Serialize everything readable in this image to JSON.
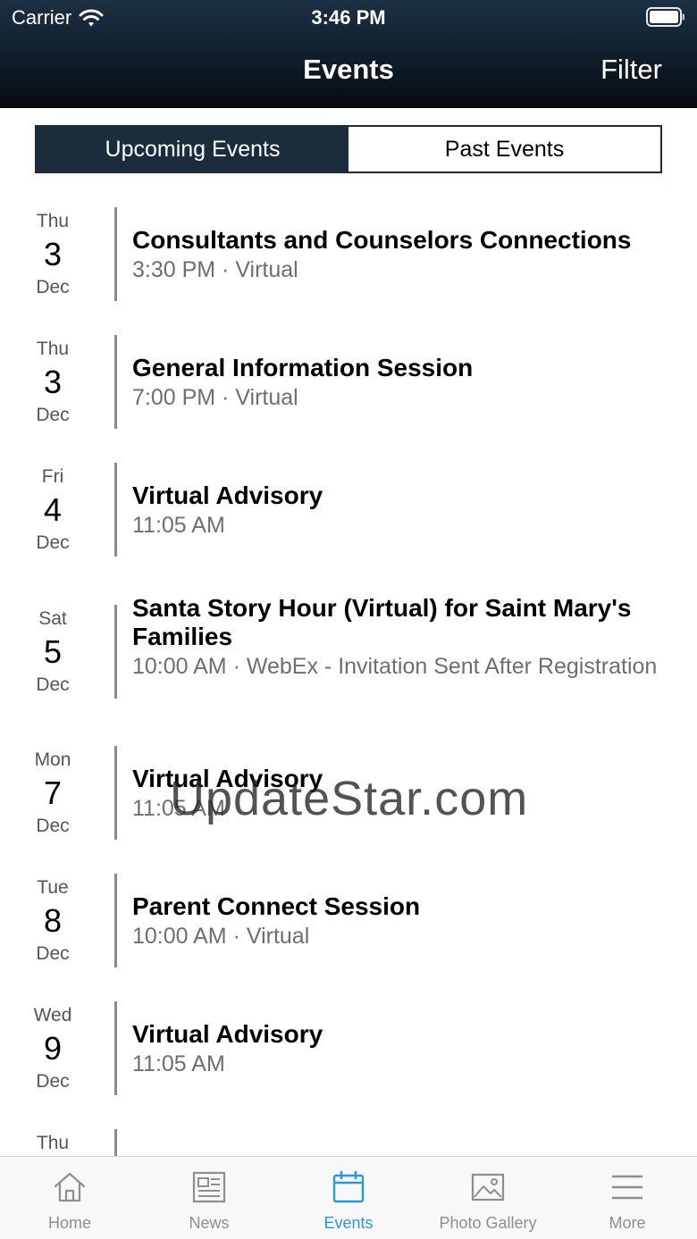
{
  "status_bar": {
    "carrier": "Carrier",
    "time": "3:46 PM"
  },
  "nav": {
    "title": "Events",
    "filter_label": "Filter"
  },
  "segments": {
    "upcoming": "Upcoming Events",
    "past": "Past Events",
    "selected": "upcoming"
  },
  "events": [
    {
      "dow": "Thu",
      "day": "3",
      "month": "Dec",
      "title": "Consultants and Counselors Connections",
      "meta": "3:30 PM · Virtual"
    },
    {
      "dow": "Thu",
      "day": "3",
      "month": "Dec",
      "title": "General Information Session",
      "meta": "7:00 PM · Virtual"
    },
    {
      "dow": "Fri",
      "day": "4",
      "month": "Dec",
      "title": "Virtual Advisory",
      "meta": "11:05 AM"
    },
    {
      "dow": "Sat",
      "day": "5",
      "month": "Dec",
      "title": "Santa Story Hour (Virtual) for Saint Mary's Families",
      "meta": "10:00 AM · WebEx - Invitation Sent After Registration"
    },
    {
      "dow": "Mon",
      "day": "7",
      "month": "Dec",
      "title": "Virtual Advisory",
      "meta": "11:05 AM"
    },
    {
      "dow": "Tue",
      "day": "8",
      "month": "Dec",
      "title": "Parent Connect Session",
      "meta": "10:00 AM · Virtual"
    },
    {
      "dow": "Wed",
      "day": "9",
      "month": "Dec",
      "title": "Virtual Advisory",
      "meta": "11:05 AM"
    },
    {
      "dow": "Thu"
    }
  ],
  "watermark": "UpdateStar.com",
  "tabbar": {
    "active": "events",
    "items": [
      {
        "id": "home",
        "label": "Home",
        "icon": "home-icon"
      },
      {
        "id": "news",
        "label": "News",
        "icon": "newspaper-icon"
      },
      {
        "id": "events",
        "label": "Events",
        "icon": "calendar-icon"
      },
      {
        "id": "photo-gallery",
        "label": "Photo Gallery",
        "icon": "image-icon"
      },
      {
        "id": "more",
        "label": "More",
        "icon": "menu-icon"
      }
    ]
  },
  "colors": {
    "header_top": "#1c3044",
    "header_bottom": "#070b10",
    "segment_active": "#1b2d3d",
    "tab_active": "#2a9ad6",
    "tab_inactive": "#8e8e8e"
  }
}
